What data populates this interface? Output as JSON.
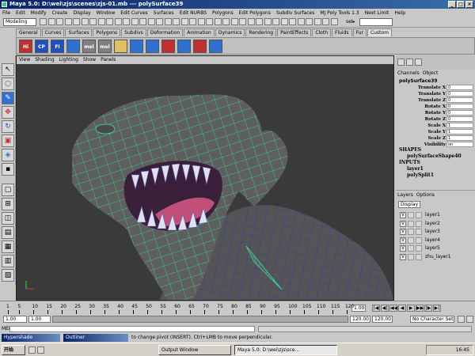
{
  "window": {
    "title": "Maya 5.0: D:\\wei\\zjs\\scenes\\zjs-01.mb  ---  polySurface39"
  },
  "menubar": [
    "File",
    "Edit",
    "Modify",
    "Create",
    "Display",
    "Window",
    "Edit Curves",
    "Surfaces",
    "Edit NURBS",
    "Polygons",
    "Edit Polygons",
    "Subdiv Surfaces",
    "MJ Poly Tools 1.3",
    "Next Limit",
    "Help"
  ],
  "statusline": {
    "mode": "Modeling",
    "sel_label": "sel▸"
  },
  "shelf_tabs": [
    {
      "label": "General",
      "active": false
    },
    {
      "label": "Curves",
      "active": false
    },
    {
      "label": "Surfaces",
      "active": false
    },
    {
      "label": "Polygons",
      "active": false
    },
    {
      "label": "Subdivs",
      "active": false
    },
    {
      "label": "Deformation",
      "active": false
    },
    {
      "label": "Animation",
      "active": false
    },
    {
      "label": "Dynamics",
      "active": false
    },
    {
      "label": "Rendering",
      "active": false
    },
    {
      "label": "PaintEffects",
      "active": false
    },
    {
      "label": "Cloth",
      "active": false
    },
    {
      "label": "Fluids",
      "active": false
    },
    {
      "label": "Fur",
      "active": false
    },
    {
      "label": "Custom",
      "active": true
    }
  ],
  "shelf_icons": [
    {
      "label": "Hi",
      "color": "#c03030"
    },
    {
      "label": "CP",
      "color": "#2050c0"
    },
    {
      "label": "FI",
      "color": "#2050c0"
    },
    {
      "label": "",
      "color": "#3070d0"
    },
    {
      "label": "mel",
      "color": "#808080"
    },
    {
      "label": "mel",
      "color": "#808080"
    },
    {
      "label": "",
      "color": "#e0c060"
    },
    {
      "label": "",
      "color": "#3070d0"
    },
    {
      "label": "",
      "color": "#3070d0"
    },
    {
      "label": "",
      "color": "#c03030"
    },
    {
      "label": "",
      "color": "#3070d0"
    },
    {
      "label": "",
      "color": "#c03030"
    },
    {
      "label": "",
      "color": "#3070d0"
    }
  ],
  "viewport": {
    "menu": [
      "View",
      "Shading",
      "Lighting",
      "Show",
      "Panels"
    ]
  },
  "channel_box": {
    "tabs": [
      "Channels",
      "Object"
    ],
    "object_name": "polySurface39",
    "channels": [
      {
        "name": "Translate X",
        "value": "0"
      },
      {
        "name": "Translate Y",
        "value": "0"
      },
      {
        "name": "Translate Z",
        "value": "0"
      },
      {
        "name": "Rotate X",
        "value": "0"
      },
      {
        "name": "Rotate Y",
        "value": "0"
      },
      {
        "name": "Rotate Z",
        "value": "0"
      },
      {
        "name": "Scale X",
        "value": "1"
      },
      {
        "name": "Scale Y",
        "value": "1"
      },
      {
        "name": "Scale Z",
        "value": "1"
      },
      {
        "name": "Visibility",
        "value": "on"
      }
    ],
    "shapes_header": "SHAPES",
    "shape_name": "polySurfaceShape40",
    "inputs_header": "INPUTS",
    "inputs": [
      "layer1",
      "polySplit1"
    ]
  },
  "layers": {
    "tabs": [
      "Layers",
      "Options"
    ],
    "display": "Display",
    "items": [
      {
        "v": "V",
        "name": "layer1"
      },
      {
        "v": "V",
        "name": "layer2"
      },
      {
        "v": "V",
        "name": "layer3"
      },
      {
        "v": "V",
        "name": "layer4"
      },
      {
        "v": "V",
        "name": "layer5"
      },
      {
        "v": "V",
        "name": "zhu_layer1"
      }
    ]
  },
  "timeline": {
    "ticks": [
      "1",
      "5",
      "10",
      "15",
      "20",
      "25",
      "30",
      "35",
      "40",
      "45",
      "50",
      "55",
      "60",
      "65",
      "70",
      "75",
      "80",
      "85",
      "90",
      "95",
      "100",
      "105",
      "110",
      "115",
      "120"
    ],
    "current_frame": "1.00"
  },
  "range": {
    "start": "1.00",
    "start2": "1.00",
    "end": "120.00",
    "end2": "120.00",
    "character_set": "No Character Set"
  },
  "cmdline": {
    "mel_label": "MEL"
  },
  "helpline": {
    "hypershade": "Hypershade",
    "outliner": "Outliner",
    "text": "to change pivot (INSERT). Ctrl+LMB to move perpendicular."
  },
  "taskbar": {
    "start": "开始",
    "tasks": [
      {
        "label": "Output Window",
        "active": false
      },
      {
        "label": "Maya 5.0: D:\\wei\\zjs\\sce...",
        "active": true
      }
    ],
    "clock": "16:45"
  }
}
